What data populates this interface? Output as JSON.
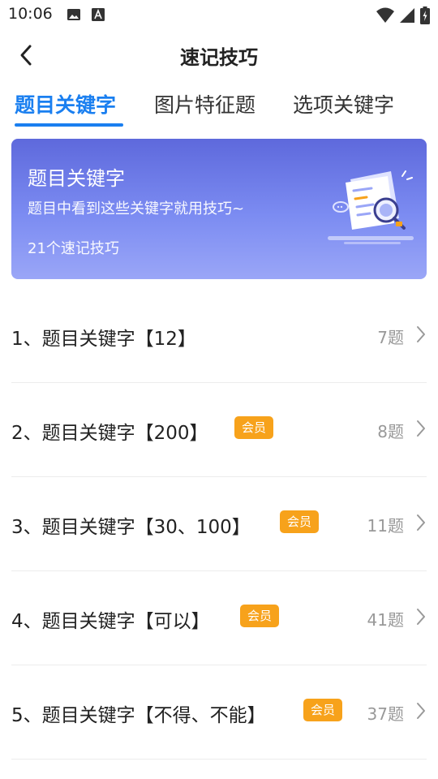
{
  "status_bar": {
    "time": "10:06",
    "left_icons": [
      "image-icon",
      "text-a-icon"
    ],
    "right_icons": [
      "wifi-icon",
      "signal-icon",
      "battery-charging-icon"
    ]
  },
  "header": {
    "title": "速记技巧",
    "back_icon": "chevron-left-icon"
  },
  "tabs": [
    {
      "label": "题目关键字",
      "active": true
    },
    {
      "label": "图片特征题",
      "active": false
    },
    {
      "label": "选项关键字",
      "active": false
    }
  ],
  "banner": {
    "title": "题目关键字",
    "subtitle": "题目中看到这些关键字就用技巧~",
    "count_text": "21个速记技巧",
    "gradient_colors": [
      "#5e69dc",
      "#9aa6f7"
    ],
    "illustration_icon": "document-magnifier-illustration"
  },
  "items": [
    {
      "title": "1、题目关键字【12】",
      "badge": "",
      "count": "7题"
    },
    {
      "title": "2、题目关键字【200】",
      "badge": "会员",
      "count": "8题"
    },
    {
      "title": "3、题目关键字【30、100】",
      "badge": "会员",
      "count": "11题"
    },
    {
      "title": "4、题目关键字【可以】",
      "badge": "会员",
      "count": "41题"
    },
    {
      "title": "5、题目关键字【不得、不能】",
      "badge": "会员",
      "count": "37题"
    }
  ],
  "colors": {
    "accent": "#1a7ff0",
    "vip_badge": "#f7a21b",
    "count_text": "#999999"
  }
}
